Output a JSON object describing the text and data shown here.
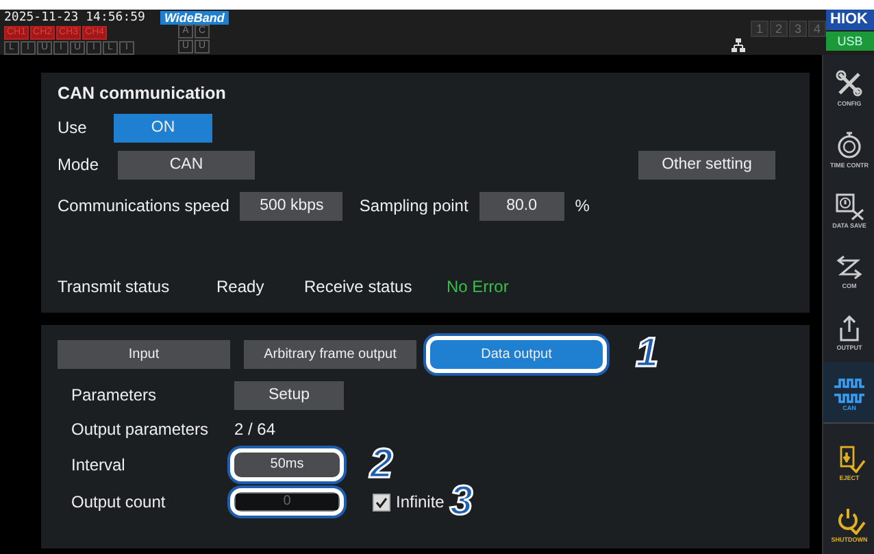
{
  "status_bar": {
    "datetime": "2025-11-23 14:56:59",
    "mode_badge": "WideBand",
    "channels": [
      "CH1",
      "CH2",
      "CH3",
      "CH4"
    ],
    "channel_flags": [
      "L",
      "I",
      "U",
      "I",
      "U",
      "I",
      "L",
      "I"
    ],
    "group_top": [
      "A",
      "C"
    ],
    "group_bottom": [
      "U",
      "U"
    ],
    "slots": [
      "1",
      "2",
      "3",
      "4"
    ],
    "brand": "HIOK",
    "storage": "USB"
  },
  "sidebar": {
    "items": [
      {
        "label": "CONFIG",
        "kind": "tools",
        "selected": false
      },
      {
        "label": "TIME CONTR",
        "kind": "timer",
        "selected": false
      },
      {
        "label": "DATA SAVE",
        "kind": "save",
        "selected": false
      },
      {
        "label": "COM",
        "kind": "com",
        "selected": false
      },
      {
        "label": "OUTPUT",
        "kind": "output",
        "selected": false
      },
      {
        "label": "CAN",
        "kind": "can",
        "selected": true
      },
      {
        "label": "EJECT",
        "kind": "eject",
        "selected": false
      },
      {
        "label": "SHUTDOWN",
        "kind": "power",
        "selected": false
      }
    ]
  },
  "can_panel": {
    "title": "CAN communication",
    "use": {
      "label": "Use",
      "value": "ON",
      "on": true
    },
    "mode": {
      "label": "Mode",
      "value": "CAN"
    },
    "other_setting": "Other setting",
    "speed": {
      "label": "Communications speed",
      "value": "500 kbps"
    },
    "sampling": {
      "label": "Sampling point",
      "value": "80.0",
      "unit": "%"
    },
    "transmit": {
      "label": "Transmit status",
      "value": "Ready"
    },
    "receive": {
      "label": "Receive status",
      "value": "No Error"
    }
  },
  "output_panel": {
    "tabs": [
      {
        "label": "Input",
        "selected": false,
        "highlighted": false
      },
      {
        "label": "Arbitrary frame output",
        "selected": false,
        "highlighted": false
      },
      {
        "label": "Data output",
        "selected": true,
        "highlighted": true,
        "callout": "1"
      }
    ],
    "parameters": {
      "label": "Parameters",
      "button": "Setup"
    },
    "output_parameters": {
      "label": "Output parameters",
      "value": "2 / 64"
    },
    "interval": {
      "label": "Interval",
      "value": "50ms",
      "highlighted": true,
      "callout": "2"
    },
    "output_count": {
      "label": "Output count",
      "value": "0",
      "highlighted": true
    },
    "infinite": {
      "label": "Infinite",
      "checked": true,
      "callout": "3"
    }
  }
}
